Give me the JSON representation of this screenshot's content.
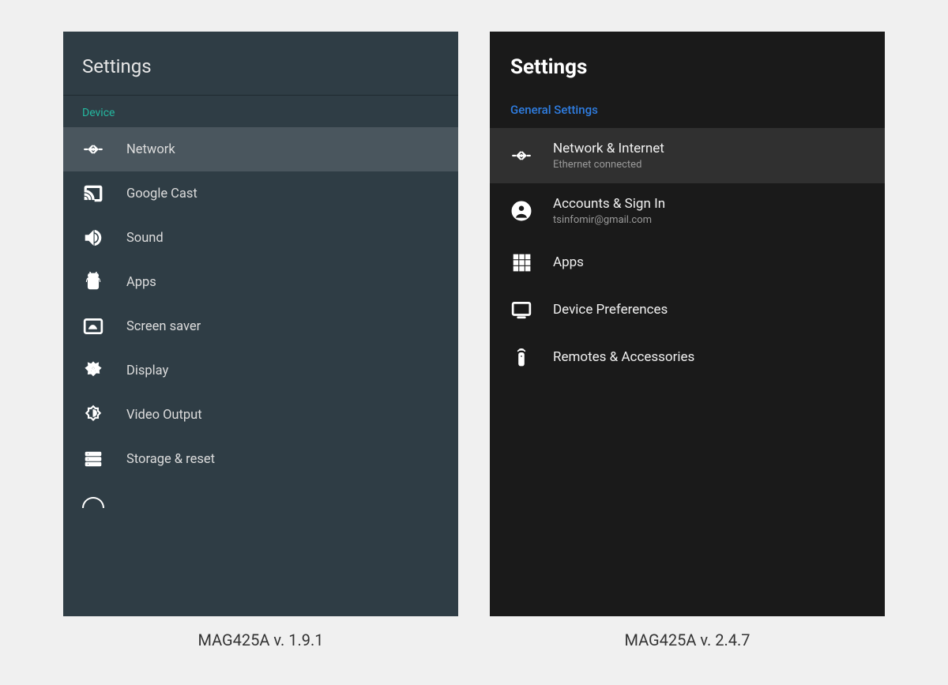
{
  "left": {
    "title": "Settings",
    "section": "Device",
    "items": [
      {
        "label": "Network",
        "icon": "ethernet-icon",
        "selected": true
      },
      {
        "label": "Google Cast",
        "icon": "cast-icon"
      },
      {
        "label": "Sound",
        "icon": "speaker-icon"
      },
      {
        "label": "Apps",
        "icon": "android-icon"
      },
      {
        "label": "Screen saver",
        "icon": "screensaver-icon"
      },
      {
        "label": "Display",
        "icon": "brightness-auto-icon"
      },
      {
        "label": "Video Output",
        "icon": "brightness-icon"
      },
      {
        "label": "Storage & reset",
        "icon": "storage-icon"
      }
    ],
    "caption": "MAG425A v. 1.9.1"
  },
  "right": {
    "title": "Settings",
    "section": "General Settings",
    "items": [
      {
        "label": "Network & Internet",
        "sub": "Ethernet connected",
        "icon": "ethernet-icon",
        "selected": true
      },
      {
        "label": "Accounts & Sign In",
        "sub": "tsinfomir@gmail.com",
        "icon": "account-icon"
      },
      {
        "label": "Apps",
        "icon": "apps-grid-icon"
      },
      {
        "label": "Device Preferences",
        "icon": "tv-icon"
      },
      {
        "label": "Remotes & Accessories",
        "icon": "remote-icon"
      }
    ],
    "caption": "MAG425A v. 2.4.7"
  }
}
